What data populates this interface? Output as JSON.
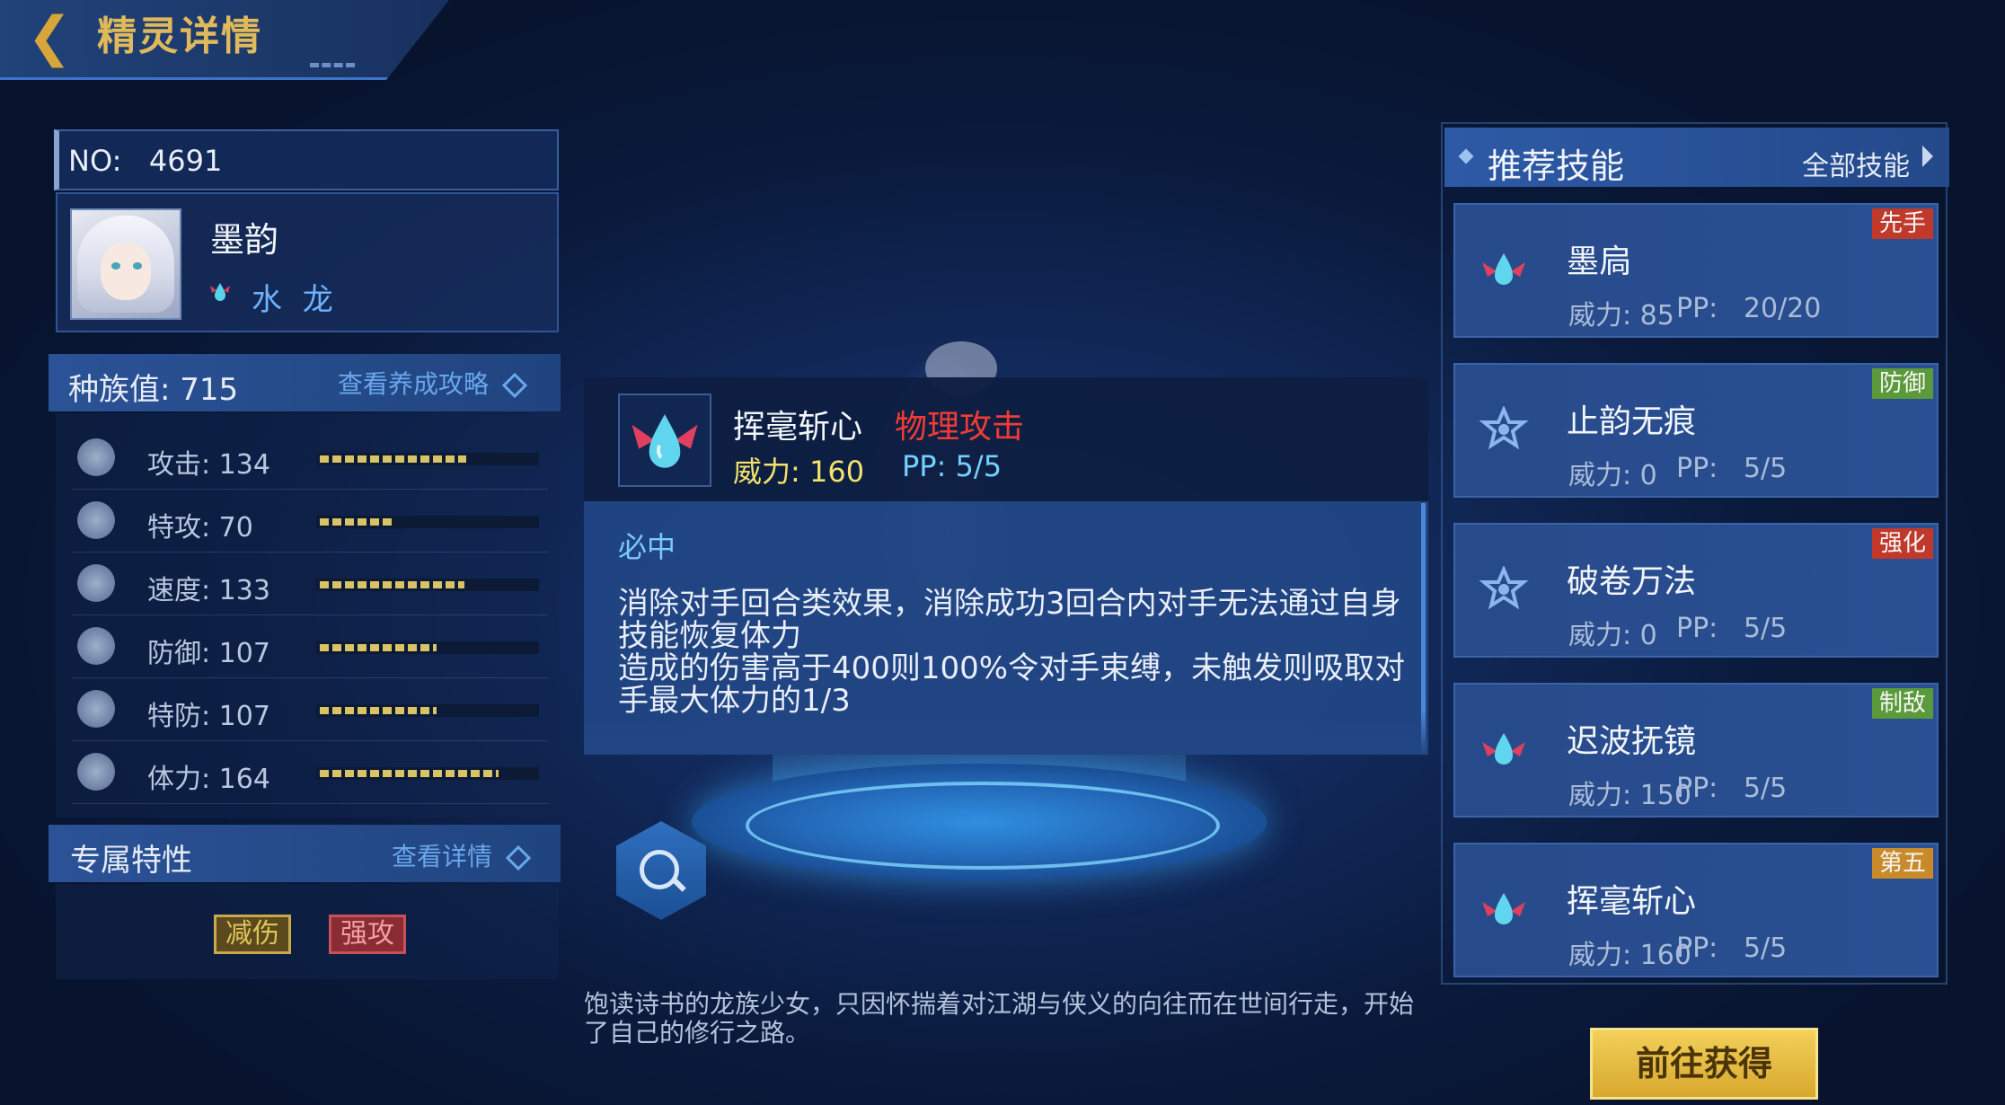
{
  "header": {
    "title": "精灵详情"
  },
  "spirit": {
    "no_label": "NO:",
    "no_value": "4691",
    "name": "墨韵",
    "type_name": "水 龙"
  },
  "race": {
    "label": "种族值:",
    "value": "715",
    "link": "查看养成攻略"
  },
  "stats": [
    {
      "label": "攻击:",
      "value": "134",
      "fill": 0.68,
      "icon": "sword-icon"
    },
    {
      "label": "特攻:",
      "value": "70",
      "fill": 0.35,
      "icon": "fire-hand-icon"
    },
    {
      "label": "速度:",
      "value": "133",
      "fill": 0.67,
      "icon": "boot-icon"
    },
    {
      "label": "防御:",
      "value": "107",
      "fill": 0.54,
      "icon": "shield-icon"
    },
    {
      "label": "特防:",
      "value": "107",
      "fill": 0.54,
      "icon": "special-shield-icon"
    },
    {
      "label": "体力:",
      "value": "164",
      "fill": 0.83,
      "icon": "bandage-icon"
    }
  ],
  "trait": {
    "label": "专属特性",
    "link": "查看详情",
    "tags": [
      "减伤",
      "强攻"
    ]
  },
  "popup": {
    "name": "挥毫斩心",
    "type": "物理攻击",
    "power_label": "威力:",
    "power_value": "160",
    "pp_label": "PP:",
    "pp_value": "5/5",
    "effect": "必中",
    "description": "消除对手回合类效果，消除成功3回合内对手无法通过自身技能恢复体力\n造成的伤害高于400则100%令对手束缚，未触发则吸取对手最大体力的1/3"
  },
  "description": "饱读诗书的龙族少女，只因怀揣着对江湖与侠义的向往而在世间行走，开始了自己的修行之路。",
  "recommended": {
    "title": "推荐技能",
    "all_link": "全部技能",
    "skills": [
      {
        "name": "墨扃",
        "power": "威力: 85",
        "pp": "PP:   20/20",
        "badge": "先手",
        "badge_color": "#c0392b",
        "icon": "water-drop-icon"
      },
      {
        "name": "止韵无痕",
        "power": "威力: 0",
        "pp": "PP:   5/5",
        "badge": "防御",
        "badge_color": "#5a9a3a",
        "icon": "star-shield-icon"
      },
      {
        "name": "破卷万法",
        "power": "威力: 0",
        "pp": "PP:   5/5",
        "badge": "强化",
        "badge_color": "#c0392b",
        "icon": "star-shield-icon"
      },
      {
        "name": "迟波抚镜",
        "power": "威力: 150",
        "pp": "PP:   5/5",
        "badge": "制敌",
        "badge_color": "#5a9a3a",
        "icon": "water-drop-icon"
      },
      {
        "name": "挥毫斩心",
        "power": "威力: 160",
        "pp": "PP:   5/5",
        "badge": "第五",
        "badge_color": "#c98a2a",
        "icon": "water-drop-icon"
      }
    ]
  },
  "go_button": "前往获得",
  "colors": {
    "accent_gold": "#e0b95b",
    "attack_red": "#f23b34",
    "pp_cyan": "#74d0ff",
    "power_yellow": "#f3e26b"
  }
}
